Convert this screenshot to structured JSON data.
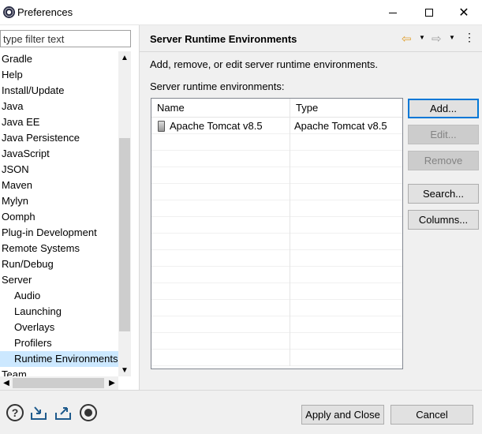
{
  "window": {
    "title": "Preferences"
  },
  "sidebar": {
    "filter_placeholder": "type filter text",
    "items": [
      {
        "label": "Gradle",
        "level": 0
      },
      {
        "label": "Help",
        "level": 0
      },
      {
        "label": "Install/Update",
        "level": 0
      },
      {
        "label": "Java",
        "level": 0
      },
      {
        "label": "Java EE",
        "level": 0
      },
      {
        "label": "Java Persistence",
        "level": 0
      },
      {
        "label": "JavaScript",
        "level": 0
      },
      {
        "label": "JSON",
        "level": 0
      },
      {
        "label": "Maven",
        "level": 0
      },
      {
        "label": "Mylyn",
        "level": 0
      },
      {
        "label": "Oomph",
        "level": 0
      },
      {
        "label": "Plug-in Development",
        "level": 0
      },
      {
        "label": "Remote Systems",
        "level": 0
      },
      {
        "label": "Run/Debug",
        "level": 0
      },
      {
        "label": "Server",
        "level": 0
      },
      {
        "label": "Audio",
        "level": 1
      },
      {
        "label": "Launching",
        "level": 1
      },
      {
        "label": "Overlays",
        "level": 1
      },
      {
        "label": "Profilers",
        "level": 1
      },
      {
        "label": "Runtime Environments",
        "level": 1,
        "selected": true
      },
      {
        "label": "Team",
        "level": 0
      }
    ]
  },
  "main": {
    "title": "Server Runtime Environments",
    "description": "Add, remove, or edit server runtime environments.",
    "section_label": "Server runtime environments:",
    "table": {
      "columns": [
        "Name",
        "Type"
      ],
      "rows": [
        {
          "name": "Apache Tomcat v8.5",
          "type": "Apache Tomcat v8.5"
        }
      ]
    },
    "buttons": {
      "add": "Add...",
      "edit": "Edit...",
      "remove": "Remove",
      "search": "Search...",
      "columns": "Columns..."
    }
  },
  "footer": {
    "apply_close": "Apply and Close",
    "cancel": "Cancel"
  },
  "icons": {
    "nav_back": "arrow-left-icon",
    "nav_forward": "arrow-right-icon",
    "help": "help-icon",
    "import": "import-icon",
    "export": "export-icon",
    "record": "record-icon"
  }
}
